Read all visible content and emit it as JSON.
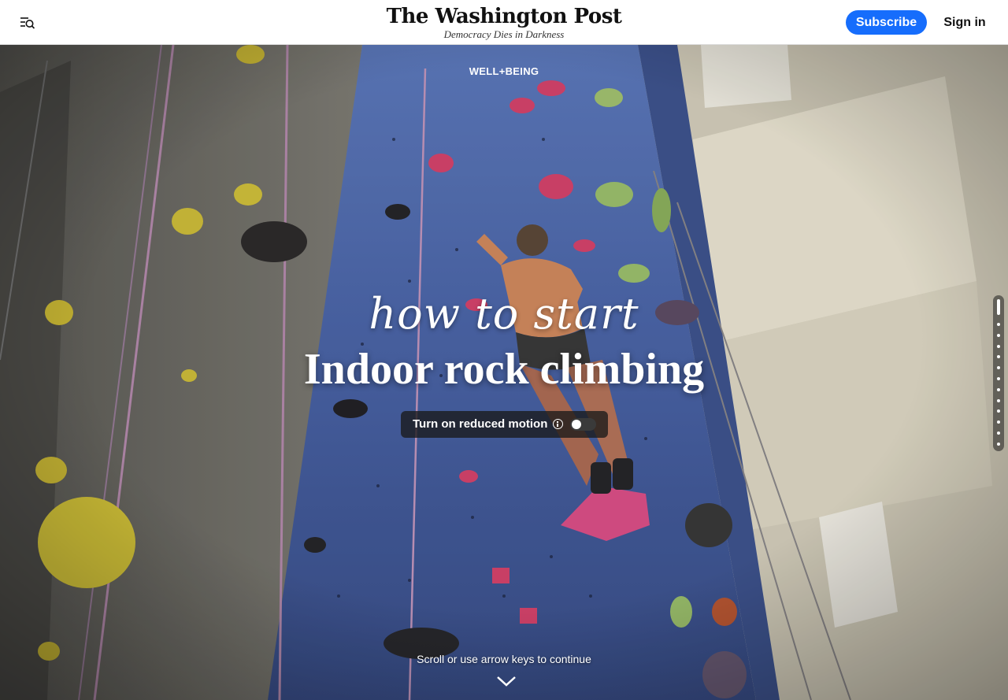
{
  "header": {
    "logo": "The Washington Post",
    "tagline": "Democracy Dies in Darkness",
    "subscribe_label": "Subscribe",
    "signin_label": "Sign in",
    "menu_icon": "menu-search-icon"
  },
  "hero": {
    "section_label": "WELL+BEING",
    "script_title": "how to start",
    "title": "Indoor rock climbing",
    "motion_toggle_label": "Turn on reduced motion",
    "motion_toggle_on": false,
    "scroll_hint": "Scroll or use arrow keys to continue",
    "chevron_icon": "chevron-down-icon"
  },
  "progress": {
    "total_sections": 13,
    "current_section": 1
  },
  "colors": {
    "accent": "#166dfc",
    "wall_blue": "#4a64a8",
    "wall_grey": "#6e6e68",
    "hold_pink": "#d9456e",
    "hold_yellow": "#d6c63a"
  }
}
